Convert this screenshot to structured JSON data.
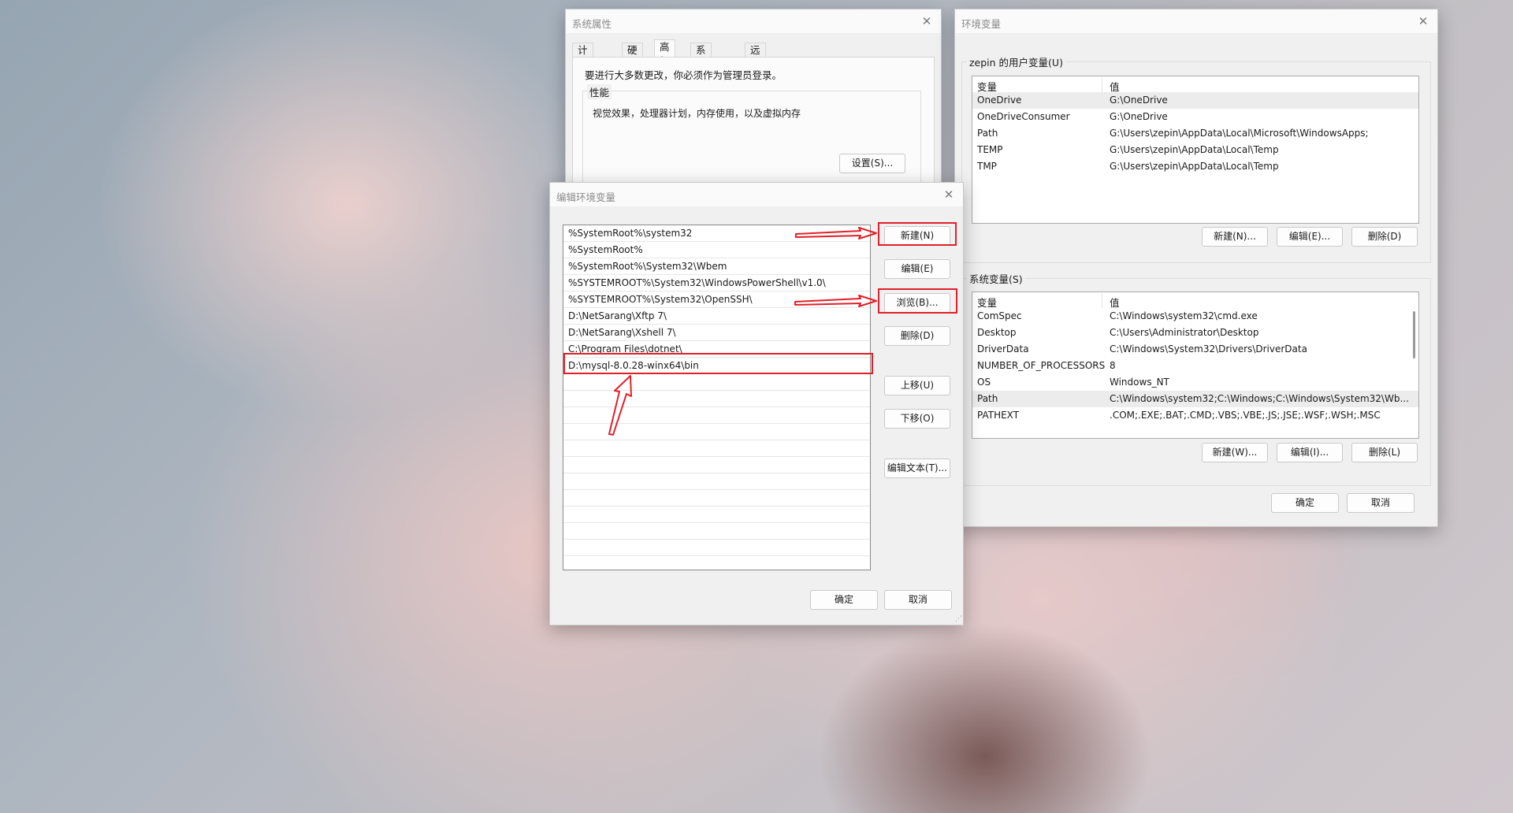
{
  "sysprops": {
    "title": "系统属性",
    "close": "✕",
    "tabs": [
      "计算机名",
      "硬件",
      "高级",
      "系统保护",
      "远程"
    ],
    "admin_note": "要进行大多数更改，你必须作为管理员登录。",
    "perf_group": "性能",
    "perf_desc": "视觉效果，处理器计划，内存使用，以及虚拟内存",
    "settings_btn": "设置(S)..."
  },
  "envvars": {
    "title": "环境变量",
    "close": "✕",
    "user_group": "zepin 的用户变量(U)",
    "col_var": "变量",
    "col_val": "值",
    "user_vars": [
      {
        "name": "OneDrive",
        "value": "G:\\OneDrive"
      },
      {
        "name": "OneDriveConsumer",
        "value": "G:\\OneDrive"
      },
      {
        "name": "Path",
        "value": "G:\\Users\\zepin\\AppData\\Local\\Microsoft\\WindowsApps;"
      },
      {
        "name": "TEMP",
        "value": "G:\\Users\\zepin\\AppData\\Local\\Temp"
      },
      {
        "name": "TMP",
        "value": "G:\\Users\\zepin\\AppData\\Local\\Temp"
      }
    ],
    "user_new": "新建(N)...",
    "user_edit": "编辑(E)...",
    "user_delete": "删除(D)",
    "sys_group": "系统变量(S)",
    "sys_vars": [
      {
        "name": "ComSpec",
        "value": "C:\\Windows\\system32\\cmd.exe"
      },
      {
        "name": "Desktop",
        "value": "C:\\Users\\Administrator\\Desktop"
      },
      {
        "name": "DriverData",
        "value": "C:\\Windows\\System32\\Drivers\\DriverData"
      },
      {
        "name": "NUMBER_OF_PROCESSORS",
        "value": "8"
      },
      {
        "name": "OS",
        "value": "Windows_NT"
      },
      {
        "name": "Path",
        "value": "C:\\Windows\\system32;C:\\Windows;C:\\Windows\\System32\\Wb..."
      },
      {
        "name": "PATHEXT",
        "value": ".COM;.EXE;.BAT;.CMD;.VBS;.VBE;.JS;.JSE;.WSF;.WSH;.MSC"
      }
    ],
    "sys_new": "新建(W)...",
    "sys_edit": "编辑(I)...",
    "sys_delete": "删除(L)",
    "ok": "确定",
    "cancel": "取消"
  },
  "editdlg": {
    "title": "编辑环境变量",
    "close": "✕",
    "paths": [
      "%SystemRoot%\\system32",
      "%SystemRoot%",
      "%SystemRoot%\\System32\\Wbem",
      "%SYSTEMROOT%\\System32\\WindowsPowerShell\\v1.0\\",
      "%SYSTEMROOT%\\System32\\OpenSSH\\",
      "D:\\NetSarang\\Xftp 7\\",
      "D:\\NetSarang\\Xshell 7\\",
      "C:\\Program Files\\dotnet\\",
      "D:\\mysql-8.0.28-winx64\\bin"
    ],
    "btn_new": "新建(N)",
    "btn_edit": "编辑(E)",
    "btn_browse": "浏览(B)...",
    "btn_delete": "删除(D)",
    "btn_up": "上移(U)",
    "btn_down": "下移(O)",
    "btn_edit_text": "编辑文本(T)...",
    "ok": "确定",
    "cancel": "取消"
  },
  "colors": {
    "highlight": "#e0202a",
    "dialog_bg": "#f0f0f0"
  }
}
